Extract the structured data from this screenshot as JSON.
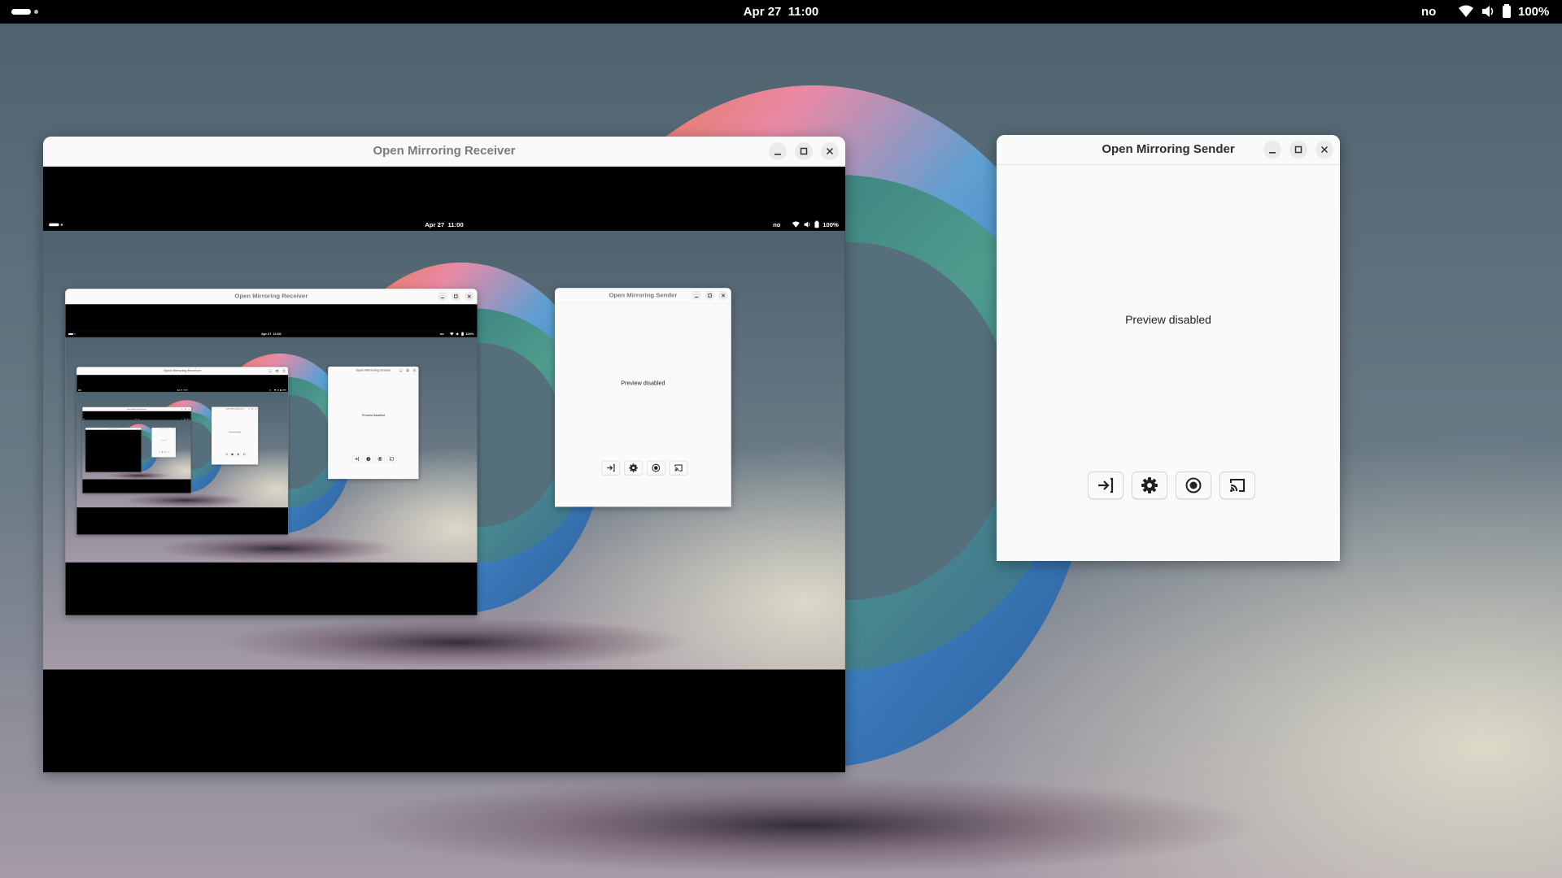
{
  "topbar": {
    "clock": "Apr 27  11:00",
    "keyboard_layout": "no",
    "battery_percent": "100%"
  },
  "receiver_window": {
    "title": "Open Mirroring Receiver"
  },
  "sender_window": {
    "title": "Open Mirroring Sender",
    "preview_text": "Preview disabled"
  },
  "icons": {
    "activities": "activities-indicator",
    "wifi": "wifi-icon",
    "volume": "volume-icon",
    "battery": "battery-icon",
    "minimize": "minimize-icon",
    "maximize": "maximize-icon",
    "close": "close-icon",
    "connect": "login-arrow-icon",
    "settings": "gear-icon",
    "record": "record-icon",
    "cast": "cast-icon"
  },
  "colors": {
    "topbar": "#000000",
    "window_bg": "#fafafa",
    "desktop": "#4f6470"
  }
}
